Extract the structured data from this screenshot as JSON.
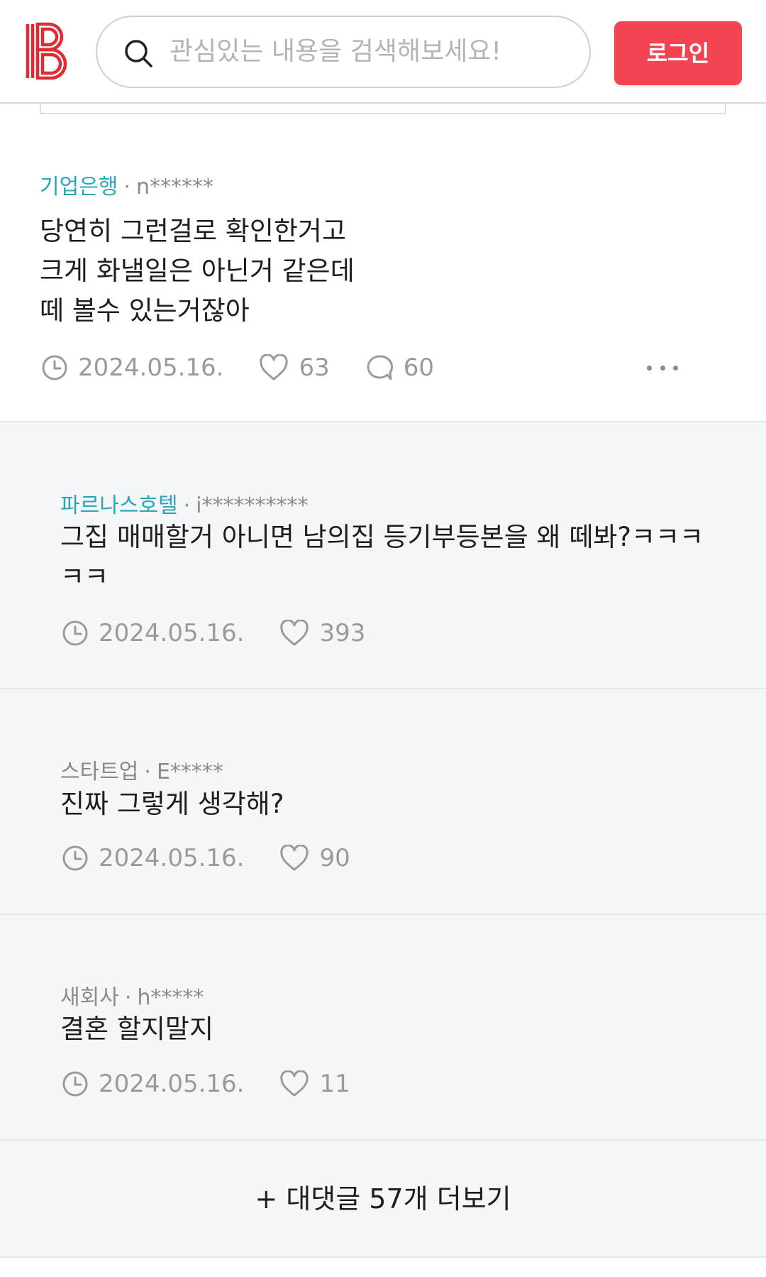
{
  "header": {
    "search_placeholder": "관심있는 내용을 검색해보세요!",
    "login_label": "로그인",
    "brand_color": "#f24451"
  },
  "comments": [
    {
      "company": "기업은행",
      "separator": "·",
      "author": "n******",
      "text": "당연히 그런걸로 확인한거고\n크게 화낼일은 아닌거 같은데\n떼 볼수 있는거잖아",
      "date": "2024.05.16.",
      "likes": "63",
      "replies": "60"
    }
  ],
  "replies": [
    {
      "company": "파르나스호텔",
      "separator": "·",
      "author": "i**********",
      "text": "그집 매매할거 아니면 남의집 등기부등본을 왜 떼봐?ㅋㅋㅋㅋㅋ",
      "date": "2024.05.16.",
      "likes": "393"
    },
    {
      "company": "스타트업",
      "separator": "·",
      "author": "E*****",
      "text": "진짜 그렇게 생각해?",
      "date": "2024.05.16.",
      "likes": "90"
    },
    {
      "company": "새회사",
      "separator": "·",
      "author": "h*****",
      "text": "결혼 할지말지",
      "date": "2024.05.16.",
      "likes": "11"
    }
  ],
  "load_more_label": "+ 대댓글 57개 더보기",
  "icons": {
    "clock": "clock-icon",
    "heart": "heart-icon",
    "comment": "comment-bubble-icon",
    "more": "more-dots-icon",
    "search": "search-icon",
    "logo": "blind-logo"
  }
}
